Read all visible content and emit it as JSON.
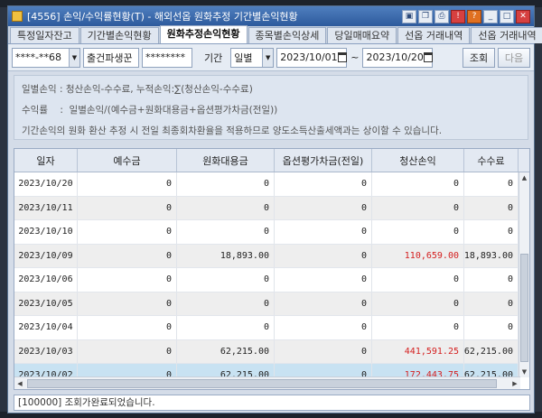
{
  "window": {
    "title": "[4556] 손익/수익률현황(T) - 해외선옵 원화추정 기간별손익현황"
  },
  "tabs": [
    {
      "label": "특정일자잔고",
      "active": false
    },
    {
      "label": "기간별손익현황",
      "active": false
    },
    {
      "label": "원화추정손익현황",
      "active": true
    },
    {
      "label": "종목별손익상세",
      "active": false
    },
    {
      "label": "당일매매요약",
      "active": false
    },
    {
      "label": "선옵 거래내역",
      "active": false
    },
    {
      "label": "선옵 거래내역",
      "active": false
    }
  ],
  "toolbar": {
    "account": "****-**68",
    "account_type": "출건파생꾼",
    "password": "********",
    "period_label": "기간",
    "period_type": "일별",
    "date_from": "2023/10/01",
    "date_sep": "~",
    "date_to": "2023/10/20",
    "query_label": "조회",
    "next_label": "다음"
  },
  "info": {
    "line1": "일별손익 : 청산손익-수수료, 누적손익:∑(청산손익-수수료)",
    "line2": "수익률    :  일별손익/(예수금+원화대용금+옵션평가차금(전일))",
    "line3": "기간손익의 원화 환산 추정 시 전일 최종회차환율을 적용하므로 양도소득산출세액과는 상이할 수 있습니다."
  },
  "table": {
    "columns": [
      "일자",
      "예수금",
      "원화대용금",
      "옵션평가차금(전일)",
      "청산손익",
      "수수료"
    ],
    "rows": [
      {
        "date": "2023/10/20",
        "deposit": "0",
        "substitute": "0",
        "option_eval": "0",
        "pnl": "0",
        "fee": "0",
        "pnl_red": false
      },
      {
        "date": "2023/10/11",
        "deposit": "0",
        "substitute": "0",
        "option_eval": "0",
        "pnl": "0",
        "fee": "0",
        "pnl_red": false
      },
      {
        "date": "2023/10/10",
        "deposit": "0",
        "substitute": "0",
        "option_eval": "0",
        "pnl": "0",
        "fee": "0",
        "pnl_red": false
      },
      {
        "date": "2023/10/09",
        "deposit": "0",
        "substitute": "18,893.00",
        "option_eval": "0",
        "pnl": "110,659.00",
        "fee": "18,893.00",
        "pnl_red": true
      },
      {
        "date": "2023/10/06",
        "deposit": "0",
        "substitute": "0",
        "option_eval": "0",
        "pnl": "0",
        "fee": "0",
        "pnl_red": false
      },
      {
        "date": "2023/10/05",
        "deposit": "0",
        "substitute": "0",
        "option_eval": "0",
        "pnl": "0",
        "fee": "0",
        "pnl_red": false
      },
      {
        "date": "2023/10/04",
        "deposit": "0",
        "substitute": "0",
        "option_eval": "0",
        "pnl": "0",
        "fee": "0",
        "pnl_red": false
      },
      {
        "date": "2023/10/03",
        "deposit": "0",
        "substitute": "62,215.00",
        "option_eval": "0",
        "pnl": "441,591.25",
        "fee": "62,215.00",
        "pnl_red": true
      },
      {
        "date": "2023/10/02",
        "deposit": "0",
        "substitute": "62,215.00",
        "option_eval": "0",
        "pnl": "172,443.75",
        "fee": "62,215.00",
        "pnl_red": true
      }
    ]
  },
  "status": {
    "message": "[100000] 조회가완료되었습니다."
  },
  "colors": {
    "title_bar": "#2d5a9c",
    "profit_red": "#d42020",
    "selected_row": "#c8e2f2"
  }
}
